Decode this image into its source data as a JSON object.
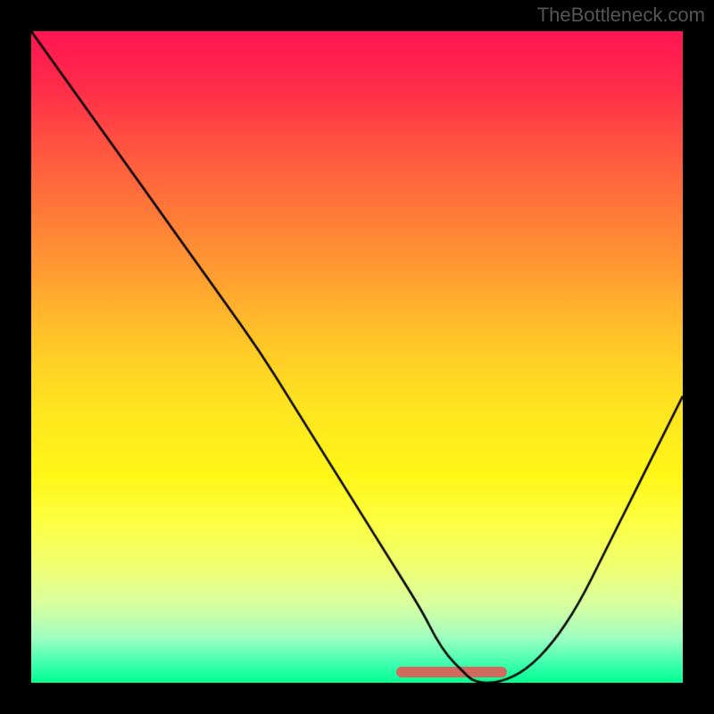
{
  "watermark_text": "TheBottleneck.com",
  "chart_data": {
    "type": "line",
    "title": "",
    "xlabel": "",
    "ylabel": "",
    "xlim": [
      0,
      100
    ],
    "ylim": [
      0,
      100
    ],
    "grid": false,
    "legend": false,
    "background_gradient": {
      "top": "#ff1552",
      "mid": "#fff010",
      "bottom": "#00ff90"
    },
    "series": [
      {
        "name": "bottleneck-curve",
        "color": "#000000",
        "x": [
          0,
          5,
          10,
          15,
          20,
          25,
          30,
          35,
          40,
          45,
          50,
          55,
          60,
          62,
          64,
          66,
          68,
          72,
          76,
          80,
          84,
          88,
          92,
          96,
          100
        ],
        "values": [
          100,
          93,
          86,
          79,
          72,
          65,
          58,
          51,
          43,
          35,
          27,
          19,
          11,
          7,
          4,
          2,
          0,
          0,
          2,
          6,
          12,
          20,
          28,
          36,
          44
        ]
      }
    ],
    "sweet_spot": {
      "x_start": 56,
      "x_end": 73,
      "color": "#d16a5e"
    }
  }
}
